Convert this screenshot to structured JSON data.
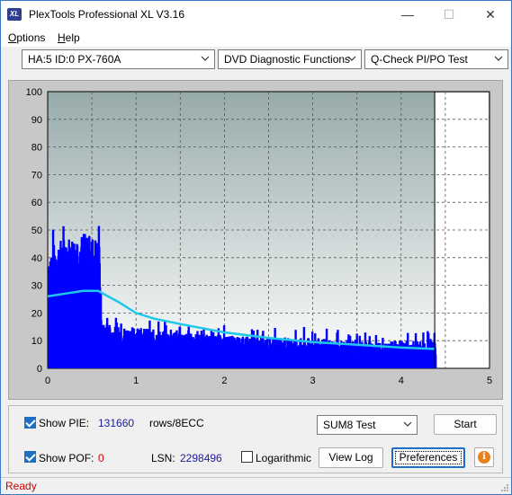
{
  "window": {
    "icon_text": "XL",
    "title": "PlexTools Professional XL V3.16",
    "minimize": "—",
    "maximize": "☐",
    "close": "✕"
  },
  "menu": {
    "items": [
      {
        "label": "Options",
        "accel": "O",
        "rest": "ptions"
      },
      {
        "label": "Help",
        "accel": "H",
        "rest": "elp"
      }
    ]
  },
  "toolbar": {
    "drive": "HA:5 ID:0  PX-760A",
    "function": "DVD Diagnostic Functions",
    "test": "Q-Check PI/PO Test"
  },
  "chart_data": {
    "type": "bar",
    "title": "",
    "xlabel": "",
    "ylabel": "",
    "xlim": [
      0,
      5
    ],
    "ylim": [
      0,
      100
    ],
    "x_ticks": [
      "0",
      "1",
      "2",
      "3",
      "4",
      "5"
    ],
    "y_ticks": [
      "0",
      "10",
      "20",
      "30",
      "40",
      "50",
      "60",
      "70",
      "80",
      "90",
      "100"
    ],
    "grid": true,
    "data_end_x": 4.38,
    "colors": {
      "bars": "#0000ff",
      "line": "#1fc8ea",
      "marker": "#000000"
    },
    "series": [
      {
        "kind": "bars",
        "description_points_x": [
          0.0,
          0.1,
          0.2,
          0.3,
          0.4,
          0.5,
          0.57,
          0.6,
          0.8,
          1.0,
          1.2,
          1.5,
          2.0,
          2.5,
          3.0,
          3.5,
          4.0,
          4.38
        ],
        "values": [
          40,
          42,
          44,
          44,
          45,
          44,
          43,
          14,
          13,
          13,
          12,
          11,
          10,
          9,
          9,
          8,
          8,
          8
        ]
      },
      {
        "kind": "line",
        "x": [
          0.0,
          0.2,
          0.4,
          0.57,
          0.8,
          1.0,
          1.2,
          1.5,
          2.0,
          2.5,
          3.0,
          3.5,
          4.0,
          4.38
        ],
        "values": [
          26,
          27,
          28,
          28,
          24,
          20,
          18,
          16,
          13,
          11,
          9.5,
          8.5,
          7.5,
          7
        ]
      }
    ]
  },
  "bottom": {
    "show_pie_label": "Show PIE:",
    "pie_value": "131660",
    "pie_unit": "rows/8ECC",
    "show_pof_label": "Show POF:",
    "pof_value": "0",
    "lsn_label": "LSN:",
    "lsn_value": "2298496",
    "logarithmic_label": "Logarithmic",
    "sum_select": "SUM8 Test",
    "start": "Start",
    "view_log": "View Log",
    "preferences": "Preferences",
    "info_icon": "i"
  },
  "status": {
    "text": "Ready"
  }
}
